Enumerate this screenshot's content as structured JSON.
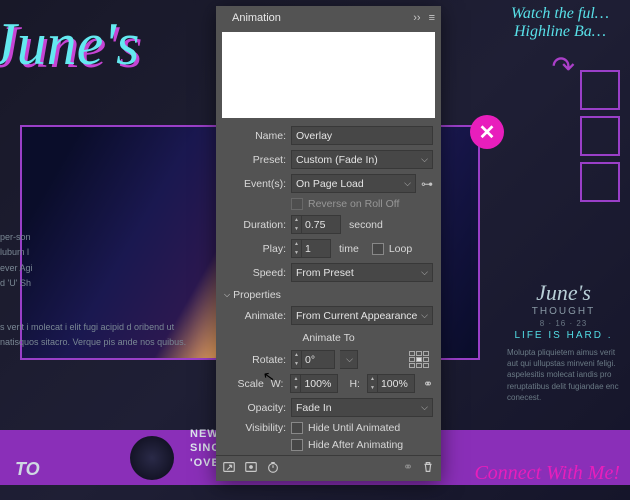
{
  "panel": {
    "title": "Animation",
    "name": {
      "label": "Name:",
      "value": "Overlay"
    },
    "preset": {
      "label": "Preset:",
      "value": "Custom (Fade In)"
    },
    "events": {
      "label": "Event(s):",
      "value": "On Page Load"
    },
    "reverse": {
      "label": "Reverse on Roll Off"
    },
    "duration": {
      "label": "Duration:",
      "value": "0.75",
      "unit": "second"
    },
    "play": {
      "label": "Play:",
      "value": "1",
      "unit": "time",
      "loop_label": "Loop"
    },
    "speed": {
      "label": "Speed:",
      "value": "From Preset"
    },
    "properties_label": "Properties",
    "animate": {
      "label": "Animate:",
      "value": "From Current Appearance"
    },
    "animate_to": "Animate To",
    "rotate": {
      "label": "Rotate:",
      "value": "0°"
    },
    "scale": {
      "label": "Scale",
      "w_label": "W:",
      "w_value": "100%",
      "h_label": "H:",
      "h_value": "100%"
    },
    "opacity": {
      "label": "Opacity:",
      "value": "Fade In"
    },
    "visibility": {
      "label": "Visibility:",
      "hide_until": "Hide Until Animated",
      "hide_after": "Hide After Animating"
    }
  },
  "bg": {
    "title": "June's",
    "watch": "Watch the ful… Highline Ba…",
    "close": "✕",
    "side": {
      "cursive": "June's",
      "sub": "THOUGHT",
      "date": "8 · 16 · 23",
      "life": "LIFE IS HARD .",
      "lorem": "Molupta pliquietem aimus verit aut qui ullupstas minveni feligi. aspelesitis molecat iandis pro reruptatibus delit fugiandae enc conecest."
    },
    "text1": "per-son lubum l ever Agi d 'U' Sh",
    "text2": "s verit i molecat i elit fugi acipid d oribend ut natisquos sitacro. Verque pis ande nos quibus.",
    "new": "NEW\nSINGLE\n'OVER YOU'",
    "over": "Over You",
    "connect": "Connect With Me!",
    "to": "TO"
  }
}
